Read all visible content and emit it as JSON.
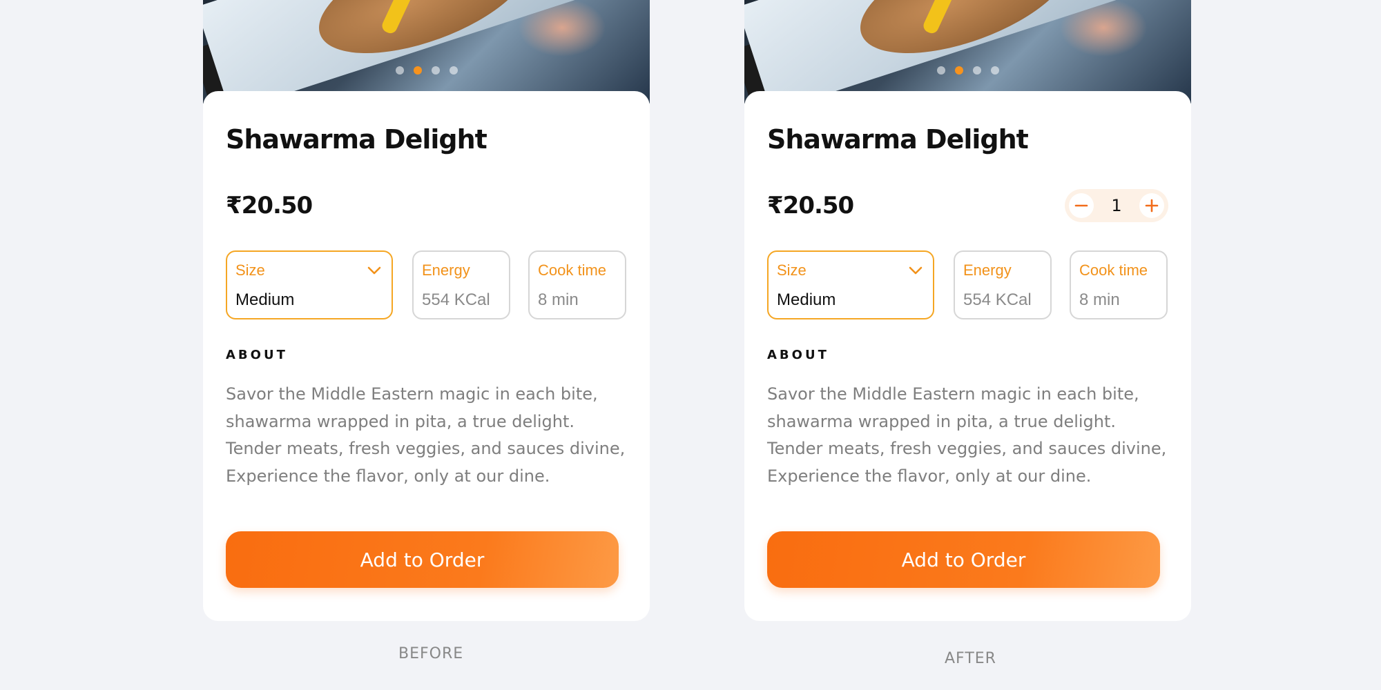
{
  "panels": {
    "before": {
      "title": "Shawarma Delight",
      "price": "₹20.50",
      "chips": {
        "size_label": "Size",
        "size_value": "Medium",
        "energy_label": "Energy",
        "energy_value": "554 KCal",
        "cook_label": "Cook time",
        "cook_value": "8 min"
      },
      "about_heading": "ABOUT",
      "about_lines": [
        "Savor the Middle Eastern magic in each bite,",
        "shawarma wrapped in pita, a true delight.",
        "Tender meats, fresh veggies, and sauces divine,",
        "Experience the flavor, only at our dine."
      ],
      "button_label": "Add to Order",
      "caption": "BEFORE"
    },
    "after": {
      "title": "Shawarma Delight",
      "price": "₹20.50",
      "quantity": "1",
      "chips": {
        "size_label": "Size",
        "size_value": "Medium",
        "energy_label": "Energy",
        "energy_value": "554 KCal",
        "cook_label": "Cook time",
        "cook_value": "8 min"
      },
      "about_heading": "ABOUT",
      "about_lines": [
        "Savor the Middle Eastern magic in each bite,",
        "shawarma wrapped in pita, a true delight.",
        "Tender meats, fresh veggies, and sauces divine,",
        "Experience the flavor, only at our dine."
      ],
      "button_label": "Add to Order",
      "caption": "AFTER"
    }
  },
  "carousel": {
    "count": 4,
    "active_index": 1
  },
  "icons": {
    "chevron": "chevron-down-icon",
    "minus": "minus-icon",
    "plus": "plus-icon"
  },
  "colors": {
    "accent": "#f7931e",
    "button_start": "#f96d10",
    "button_end": "#fd9a45",
    "size_border": "#f5a623",
    "background": "#f2f3f7"
  }
}
